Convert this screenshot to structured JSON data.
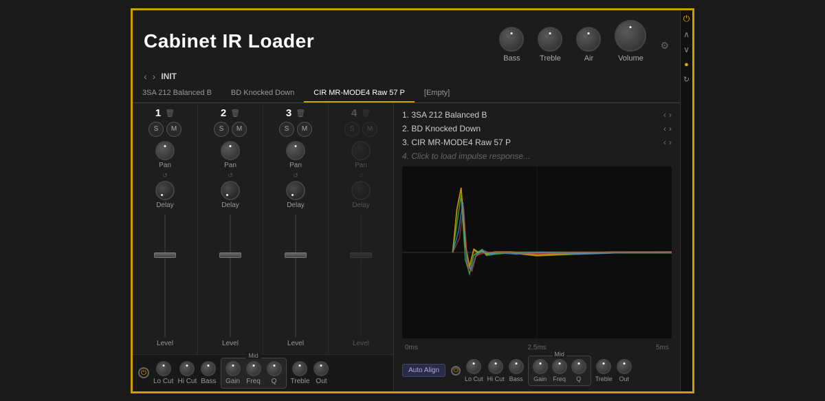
{
  "app": {
    "title": "Cabinet IR Loader"
  },
  "header": {
    "knobs": [
      {
        "id": "bass",
        "label": "Bass",
        "size": "medium"
      },
      {
        "id": "treble",
        "label": "Treble",
        "size": "medium"
      },
      {
        "id": "air",
        "label": "Air",
        "size": "medium"
      },
      {
        "id": "volume",
        "label": "Volume",
        "size": "large"
      }
    ]
  },
  "preset": {
    "name": "INIT",
    "nav_back": "<",
    "nav_fwd": ">"
  },
  "tabs": [
    {
      "id": "tab1",
      "label": "3SA 212 Balanced B",
      "active": false
    },
    {
      "id": "tab2",
      "label": "BD Knocked Down",
      "active": false
    },
    {
      "id": "tab3",
      "label": "CIR MR-MODE4 Raw 57 P",
      "active": true
    },
    {
      "id": "tab4",
      "label": "[Empty]",
      "active": false
    }
  ],
  "channels": [
    {
      "num": "1",
      "disabled": false
    },
    {
      "num": "2",
      "disabled": false
    },
    {
      "num": "3",
      "disabled": false
    },
    {
      "num": "4",
      "disabled": true
    }
  ],
  "ir_list": [
    {
      "num": "1.",
      "name": "3SA 212 Balanced B"
    },
    {
      "num": "2.",
      "name": "BD Knocked Down"
    },
    {
      "num": "3.",
      "name": "CIR MR-MODE4 Raw 57 P"
    },
    {
      "num": "4.",
      "name": "Click to load impulse response..."
    }
  ],
  "waveform": {
    "time_labels": [
      "0ms",
      "2.5ms",
      "5ms"
    ]
  },
  "eq_bottom": {
    "auto_align": "Auto Align",
    "mid_label": "Mid",
    "controls": [
      {
        "id": "lo_cut",
        "label": "Lo Cut"
      },
      {
        "id": "hi_cut",
        "label": "Hi Cut"
      },
      {
        "id": "bass",
        "label": "Bass"
      },
      {
        "id": "gain",
        "label": "Gain"
      },
      {
        "id": "freq",
        "label": "Freq"
      },
      {
        "id": "q",
        "label": "Q"
      },
      {
        "id": "treble",
        "label": "Treble"
      },
      {
        "id": "out",
        "label": "Out"
      }
    ]
  },
  "sidebar": {
    "icons": [
      "power",
      "chevron-up",
      "chevron-down",
      "link",
      "settings"
    ]
  }
}
